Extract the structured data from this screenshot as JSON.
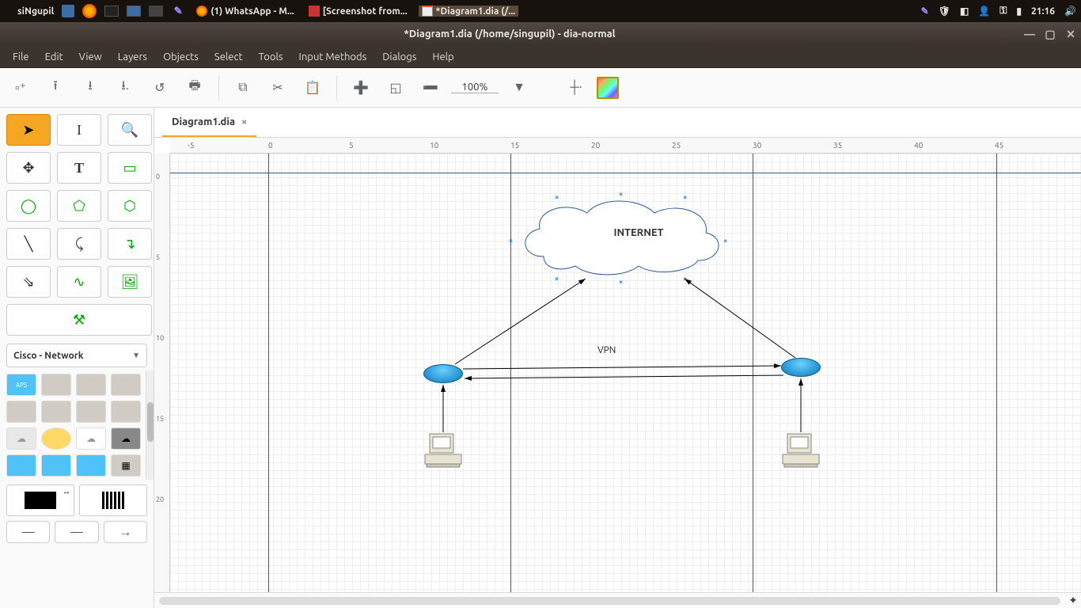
{
  "topbar": {
    "hostname": "siNgupil",
    "tasks": [
      {
        "label": "(1) WhatsApp - M..."
      },
      {
        "label": "[Screenshot from..."
      },
      {
        "label": "*Diagram1.dia (/..."
      }
    ],
    "time": "21:16"
  },
  "window": {
    "title": "*Diagram1.dia (/home/singupil) - dia-normal"
  },
  "menus": [
    "File",
    "Edit",
    "View",
    "Layers",
    "Objects",
    "Select",
    "Tools",
    "Input Methods",
    "Dialogs",
    "Help"
  ],
  "toolbar": {
    "zoom": "100%"
  },
  "tabs": {
    "active": "Diagram1.dia"
  },
  "ruler": {
    "h": [
      "-5",
      "0",
      "5",
      "10",
      "15",
      "20",
      "25",
      "30",
      "35",
      "40",
      "45"
    ],
    "v": [
      "0",
      "5",
      "10",
      "15",
      "20"
    ]
  },
  "toolbox": {
    "shapeset_label": "Cisco - Network"
  },
  "diagram": {
    "cloud_label": "INTERNET",
    "tunnel_label": "VPN"
  }
}
